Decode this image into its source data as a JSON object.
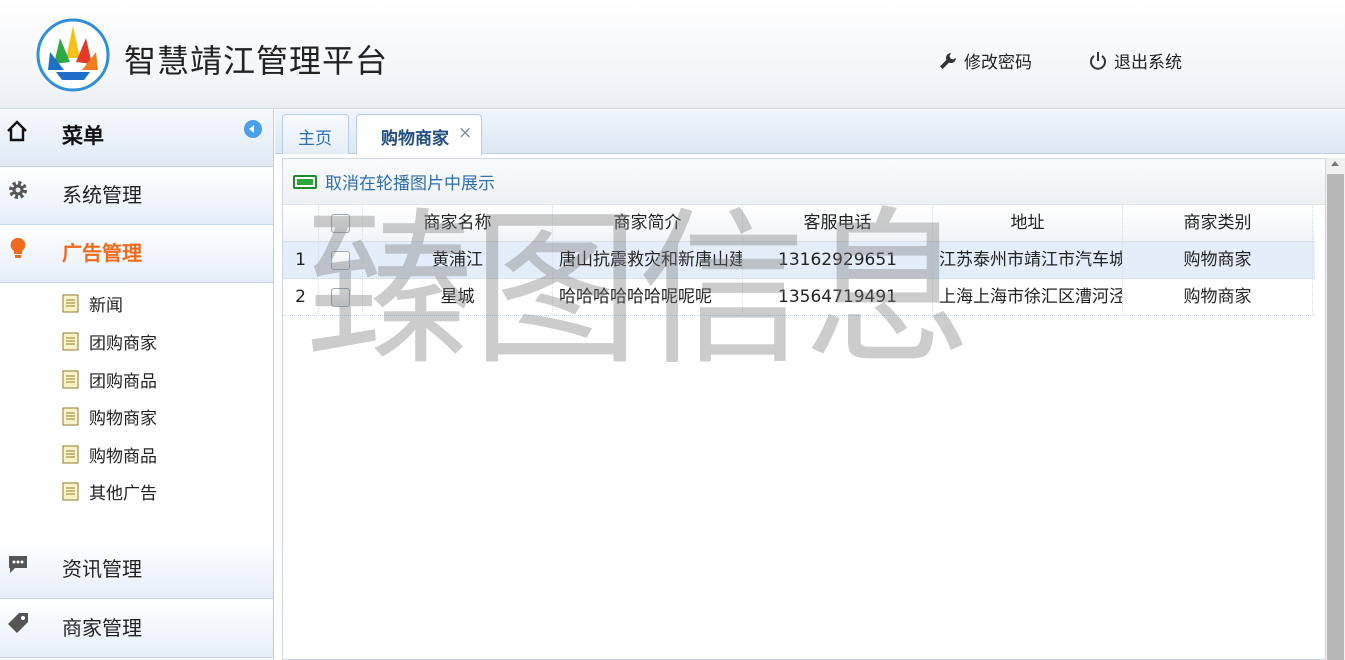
{
  "header": {
    "app_title": "智慧靖江管理平台",
    "change_password": "修改密码",
    "logout": "退出系统",
    "icons": [
      "wrench-icon",
      "power-icon"
    ]
  },
  "sidebar": {
    "menu_title": "菜单",
    "groups": [
      {
        "label": "系统管理",
        "icon": "gear-icon",
        "active": false
      },
      {
        "label": "广告管理",
        "icon": "lightbulb-icon",
        "active": true
      },
      {
        "label": "资讯管理",
        "icon": "chat-icon",
        "active": false
      },
      {
        "label": "商家管理",
        "icon": "tag-icon",
        "active": false
      }
    ],
    "ad_items": [
      "新闻",
      "团购商家",
      "团购商品",
      "购物商家",
      "购物商品",
      "其他广告"
    ]
  },
  "tabs": [
    {
      "label": "主页",
      "active": false
    },
    {
      "label": "购物商家",
      "active": true,
      "close": "×"
    }
  ],
  "toolbar": {
    "cancel_carousel": "取消在轮播图片中展示"
  },
  "grid": {
    "columns": [
      "商家名称",
      "商家简介",
      "客服电话",
      "地址",
      "商家类别"
    ],
    "rows": [
      {
        "num": "1",
        "name": "黄浦江",
        "intro": "唐山抗震救灾和新唐山建设",
        "phone": "13162929651",
        "address": "江苏泰州市靖江市汽车城",
        "category": "购物商家",
        "selected": true
      },
      {
        "num": "2",
        "name": "星城",
        "intro": "哈哈哈哈哈哈呢呢呢",
        "phone": "13564719491",
        "address": "上海上海市徐汇区漕河泾",
        "category": "购物商家",
        "selected": false
      }
    ]
  },
  "watermark": "臻图信息",
  "colors": {
    "accent_orange": "#f06a1b",
    "link_blue": "#2f6fae",
    "selected_row": "#e3eefa"
  }
}
